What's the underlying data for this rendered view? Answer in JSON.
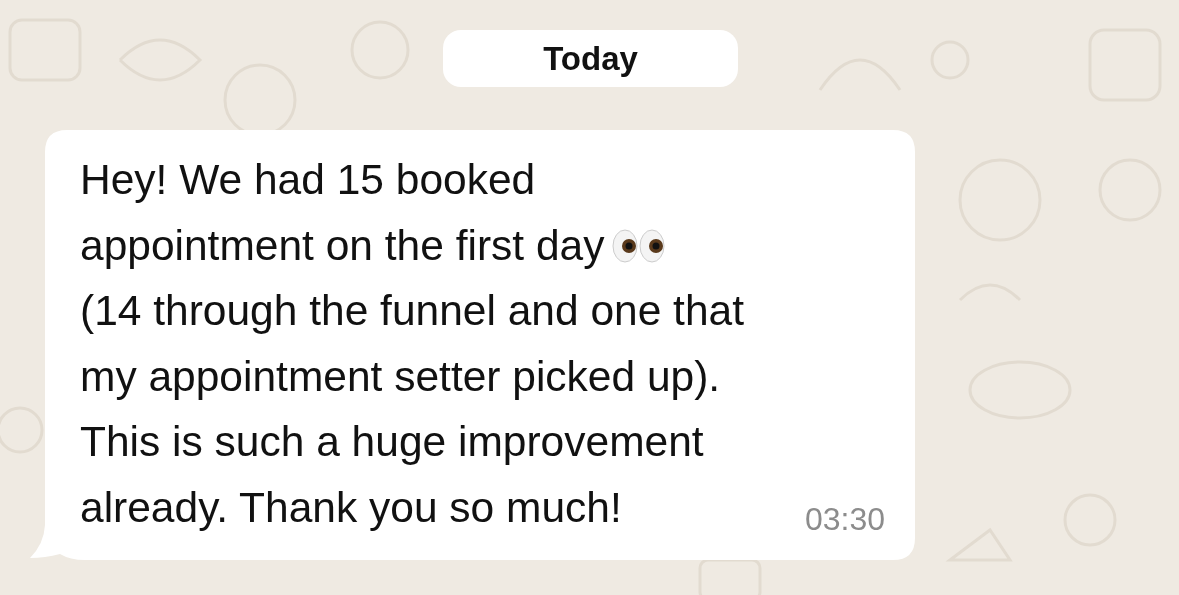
{
  "date_divider": "Today",
  "message": {
    "lines": [
      "Hey! We had 15 booked",
      "appointment on the first day",
      "(14 through the funnel and one that",
      "my appointment setter picked up).",
      "This is such a huge improvement",
      "already. Thank you so much!"
    ],
    "time": "03:30"
  }
}
